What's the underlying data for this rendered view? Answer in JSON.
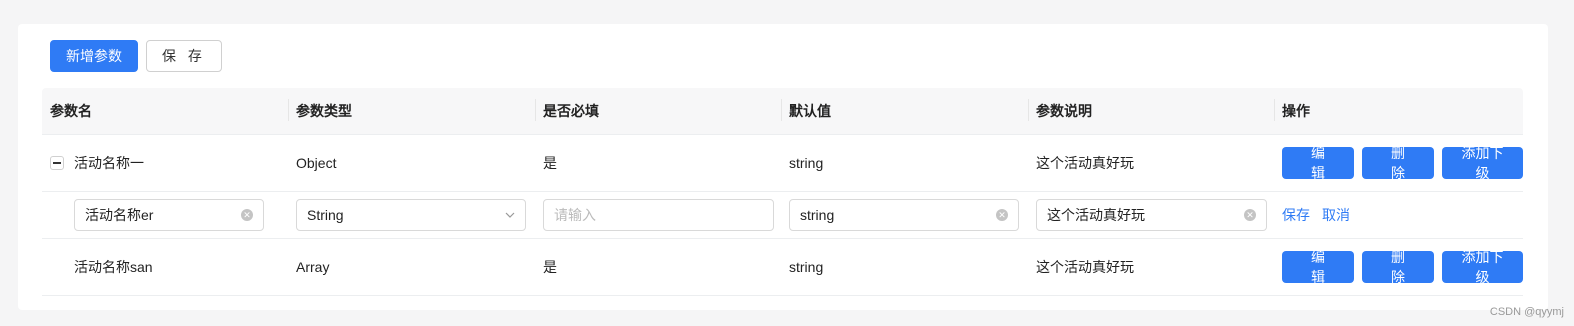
{
  "toolbar": {
    "add_param_label": "新增参数",
    "save_label": "保 存"
  },
  "columns": [
    "参数名",
    "参数类型",
    "是否必填",
    "默认值",
    "参数说明",
    "操作"
  ],
  "rows": [
    {
      "name": "活动名称一",
      "type": "Object",
      "required": "是",
      "default": "string",
      "desc": "这个活动真好玩"
    },
    {
      "name": "活动名称san",
      "type": "Array",
      "required": "是",
      "default": "string",
      "desc": "这个活动真好玩"
    }
  ],
  "edit_row": {
    "name_value": "活动名称er",
    "type_value": "String",
    "required_placeholder": "请输入",
    "default_value": "string",
    "desc_value": "这个活动真好玩",
    "save_link": "保存",
    "cancel_link": "取消"
  },
  "row_actions": {
    "edit": "编 辑",
    "delete": "删 除",
    "add_child": "添加下级"
  },
  "icons": {
    "collapse": "minus-square-icon",
    "clear": "close-circle-icon",
    "dropdown": "chevron-down-icon"
  },
  "colors": {
    "primary": "#2f7bf5",
    "header_bg": "#f7f7f8"
  },
  "watermark": "CSDN @qyymj"
}
